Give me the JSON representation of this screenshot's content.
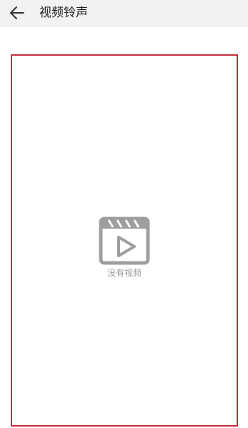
{
  "header": {
    "back_icon": "arrow-left-icon",
    "title": "视频铃声",
    "background": "#f2f2f2"
  },
  "video_area": {
    "border_color": "#c62f3b",
    "empty_icon": "video-clapperboard-icon",
    "empty_text": "没有视频"
  }
}
